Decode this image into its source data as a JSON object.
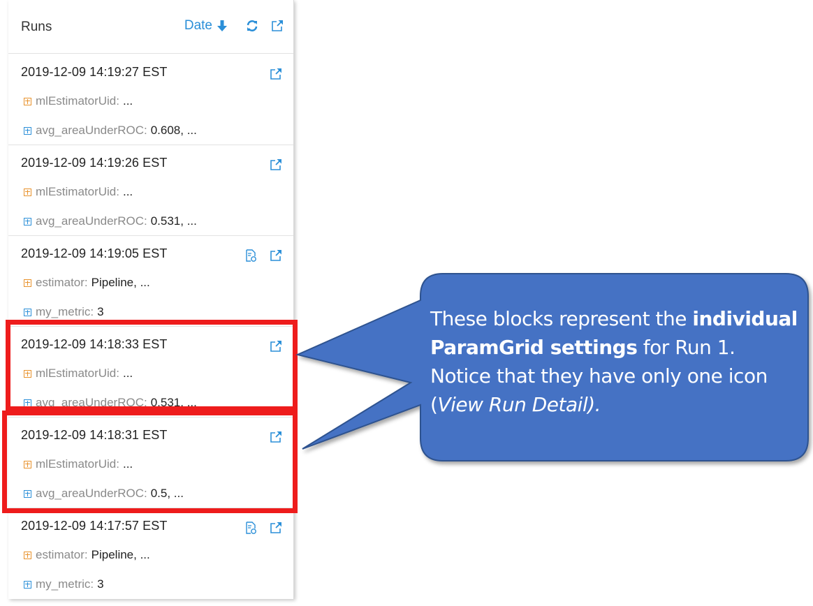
{
  "panel": {
    "title": "Runs",
    "sort_label": "Date",
    "header_icons": [
      "arrow-down-icon",
      "refresh-icon",
      "external-link-icon"
    ]
  },
  "runs": [
    {
      "timestamp": "2019-12-09 14:19:27 EST",
      "param_key": "mlEstimatorUid:",
      "param_value": "...",
      "metric_key": "avg_areaUnderROC:",
      "metric_value": "0.608, ...",
      "icons": [
        "external-link-icon"
      ]
    },
    {
      "timestamp": "2019-12-09 14:19:26 EST",
      "param_key": "mlEstimatorUid:",
      "param_value": "...",
      "metric_key": "avg_areaUnderROC:",
      "metric_value": "0.531, ...",
      "icons": [
        "external-link-icon"
      ]
    },
    {
      "timestamp": "2019-12-09 14:19:05 EST",
      "param_key": "estimator:",
      "param_value": "Pipeline, ...",
      "metric_key": "my_metric:",
      "metric_value": "3",
      "icons": [
        "notebook-icon",
        "external-link-icon"
      ]
    },
    {
      "timestamp": "2019-12-09 14:18:33 EST",
      "param_key": "mlEstimatorUid:",
      "param_value": "...",
      "metric_key": "avg_areaUnderROC:",
      "metric_value": "0.531, ...",
      "icons": [
        "external-link-icon"
      ]
    },
    {
      "timestamp": "2019-12-09 14:18:31 EST",
      "param_key": "mlEstimatorUid:",
      "param_value": "...",
      "metric_key": "avg_areaUnderROC:",
      "metric_value": "0.5, ...",
      "icons": [
        "external-link-icon"
      ]
    },
    {
      "timestamp": "2019-12-09 14:17:57 EST",
      "param_key": "estimator:",
      "param_value": "Pipeline, ...",
      "metric_key": "my_metric:",
      "metric_value": "3",
      "icons": [
        "notebook-icon",
        "external-link-icon"
      ]
    }
  ],
  "callout": {
    "text_1": "These blocks represent the ",
    "text_bold": "individual ParamGrid settings",
    "text_2": " for Run 1.  Notice that they have only one icon (",
    "text_italic": "View Run Detail).",
    "fill_color": "#4472c4",
    "stroke_color": "#2f528f"
  },
  "highlight_color": "#ee1c1c",
  "accent_color": "#2b8fd8",
  "param_icon_color": "#e8922c"
}
